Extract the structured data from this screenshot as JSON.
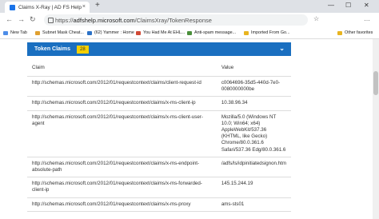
{
  "browser": {
    "tab_title": "Claims X-Ray | AD FS Help",
    "tab_close": "×",
    "new_tab": "+",
    "url_prefix": "https://",
    "url_host": "adfshelp.microsoft.com",
    "url_path": "/ClaimsXray/TokenResponse",
    "back": "←",
    "forward": "→",
    "refresh": "↻",
    "star": "☆",
    "menu": "…",
    "win_minimize": "—",
    "win_maximize": "☐",
    "win_close": "✕"
  },
  "bookmarks": [
    {
      "label": "New Tab",
      "color": "#4d8de8"
    },
    {
      "label": "Subnet Mask Cheat...",
      "color": "#e0a030"
    },
    {
      "label": "(62) Yammer : Home",
      "color": "#2c72c7"
    },
    {
      "label": "You Had Me At EHL...",
      "color": "#d04a35"
    },
    {
      "label": "Anti-spam message...",
      "color": "#4a8f3b"
    },
    {
      "label": "Imported From Go...",
      "color": "#e8b420"
    },
    {
      "label": "Other favorites",
      "color": "#e8b420"
    }
  ],
  "section": {
    "title": "Token Claims",
    "count": "28",
    "chevron": "⌄"
  },
  "table": {
    "col_claim": "Claim",
    "col_value": "Value",
    "rows": [
      {
        "claim": "http://schemas.microsoft.com/2012/01/requestcontext/claims/client-request-id",
        "value": "c0064696-35d5-440d-7e0-0080000000be"
      },
      {
        "claim": "http://schemas.microsoft.com/2012/01/requestcontext/claims/x-ms-client-ip",
        "value": "10.38.96.34"
      },
      {
        "claim": "http://schemas.microsoft.com/2012/01/requestcontext/claims/x-ms-client-user-agent",
        "value": "Mozilla/5.0 (Windows NT 10.0; Win64; x64) AppleWebKit/537.36 (KHTML, like Gecko) Chrome/80.0.361.6 Safari/537.36 Edg/80.0.361.6"
      },
      {
        "claim": "http://schemas.microsoft.com/2012/01/requestcontext/claims/x-ms-endpoint-absolute-path",
        "value": "/adfs/ls/idpinitiatedsignon.htm"
      },
      {
        "claim": "http://schemas.microsoft.com/2012/01/requestcontext/claims/x-ms-forwarded-client-ip",
        "value": "145.15.244.19"
      },
      {
        "claim": "http://schemas.microsoft.com/2012/01/requestcontext/claims/x-ms-proxy",
        "value": "ams-sts01"
      }
    ]
  }
}
